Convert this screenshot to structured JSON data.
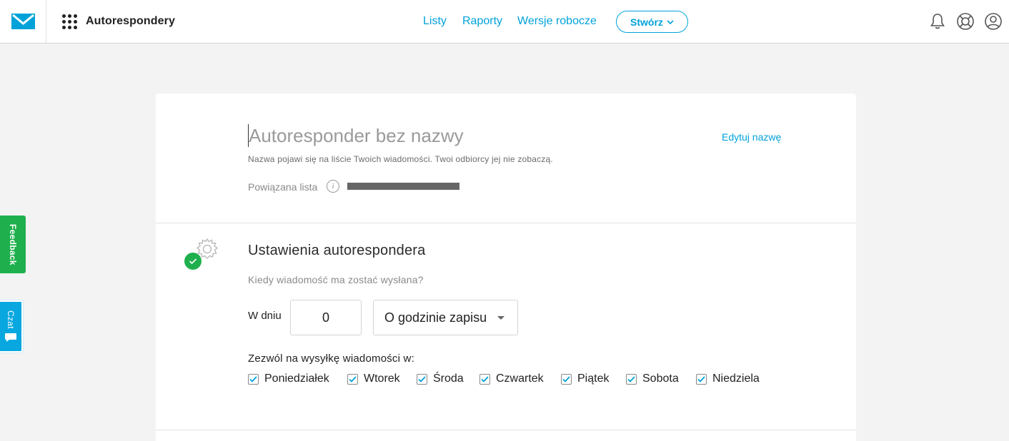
{
  "header": {
    "app_title": "Autorespondery",
    "nav": {
      "lists": "Listy",
      "reports": "Raporty",
      "drafts": "Wersje robocze"
    },
    "create_label": "Stwórz",
    "icons": [
      "bell-icon",
      "help-icon",
      "account-icon"
    ]
  },
  "form": {
    "name_placeholder": "Autoresponder bez nazwy",
    "edit_name": "Edytuj nazwę",
    "name_hint": "Nazwa pojawi się na liście Twoich wiadomości. Twoi odbiorcy jej nie zobaczą.",
    "linked_list_label": "Powiązana lista"
  },
  "settings": {
    "title": "Ustawienia autorespondera",
    "question": "Kiedy wiadomość ma zostać wysłana?",
    "day_label": "W dniu",
    "day_value": "0",
    "time_option": "O godzinie zapisu",
    "allow_label": "Zezwól na wysyłkę wiadomości w:",
    "days": [
      {
        "label": "Poniedziałek",
        "checked": true
      },
      {
        "label": "Wtorek",
        "checked": true
      },
      {
        "label": "Środa",
        "checked": true
      },
      {
        "label": "Czwartek",
        "checked": true
      },
      {
        "label": "Piątek",
        "checked": true
      },
      {
        "label": "Sobota",
        "checked": true
      },
      {
        "label": "Niedziela",
        "checked": true
      }
    ]
  },
  "side_tabs": {
    "feedback": "Feedback",
    "chat": "Czat"
  },
  "colors": {
    "accent": "#00a2d9",
    "success": "#1fb04d",
    "chat": "#08a7e0"
  }
}
